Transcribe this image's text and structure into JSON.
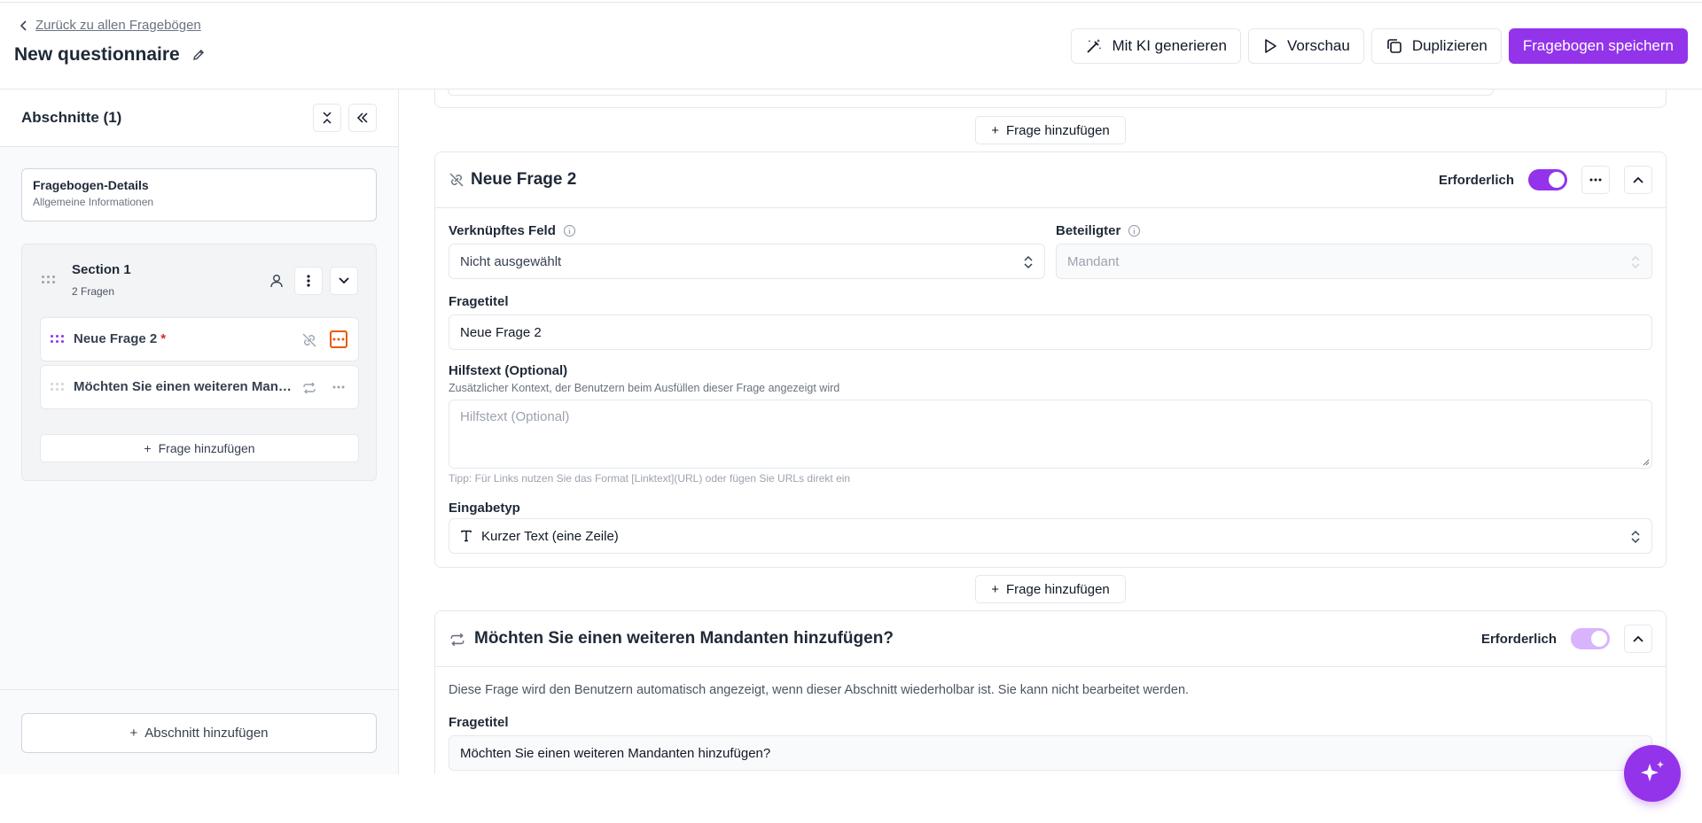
{
  "header": {
    "back_label": "Zurück zu allen Fragebögen",
    "title": "New questionnaire",
    "actions": {
      "ai_generate": "Mit KI generieren",
      "preview": "Vorschau",
      "duplicate": "Duplizieren",
      "save": "Fragebogen speichern"
    }
  },
  "sidebar": {
    "title": "Abschnitte (1)",
    "details": {
      "title": "Fragebogen-Details",
      "subtitle": "Allgemeine Informationen"
    },
    "section": {
      "title": "Section 1",
      "subtitle": "2 Fragen",
      "questions": [
        {
          "label": "Neue Frage 2",
          "required_mark": "*"
        },
        {
          "label": "Möchten Sie einen weiteren Mandanten hinzufügen?"
        }
      ],
      "add_question": "Frage hinzufügen"
    },
    "add_section": "Abschnitt hinzufügen"
  },
  "main": {
    "add_question_label": "Frage hinzufügen",
    "question1": {
      "title": "Neue Frage 2",
      "required_label": "Erforderlich",
      "linked_field_label": "Verknüpftes Feld",
      "linked_field_value": "Nicht ausgewählt",
      "participant_label": "Beteiligter",
      "participant_value": "Mandant",
      "question_title_label": "Fragetitel",
      "question_title_value": "Neue Frage 2",
      "help_label": "Hilfstext (Optional)",
      "help_hint": "Zusätzlicher Kontext, der Benutzern beim Ausfüllen dieser Frage angezeigt wird",
      "help_placeholder": "Hilfstext (Optional)",
      "help_tip": "Tipp: Für Links nutzen Sie das Format [Linktext](URL) oder fügen Sie URLs direkt ein",
      "input_type_label": "Eingabetyp",
      "input_type_value": "Kurzer Text (eine Zeile)"
    },
    "question2": {
      "title": "Möchten Sie einen weiteren Mandanten hinzufügen?",
      "required_label": "Erforderlich",
      "info": "Diese Frage wird den Benutzern automatisch angezeigt, wenn dieser Abschnitt wiederholbar ist. Sie kann nicht bearbeitet werden.",
      "question_title_label": "Fragetitel",
      "question_title_value": "Möchten Sie einen weiteren Mandanten hinzufügen?"
    }
  },
  "colors": {
    "accent": "#9333ea",
    "accent_light": "#d8b4fe",
    "focus": "#ea580c",
    "required": "#dc2626"
  }
}
